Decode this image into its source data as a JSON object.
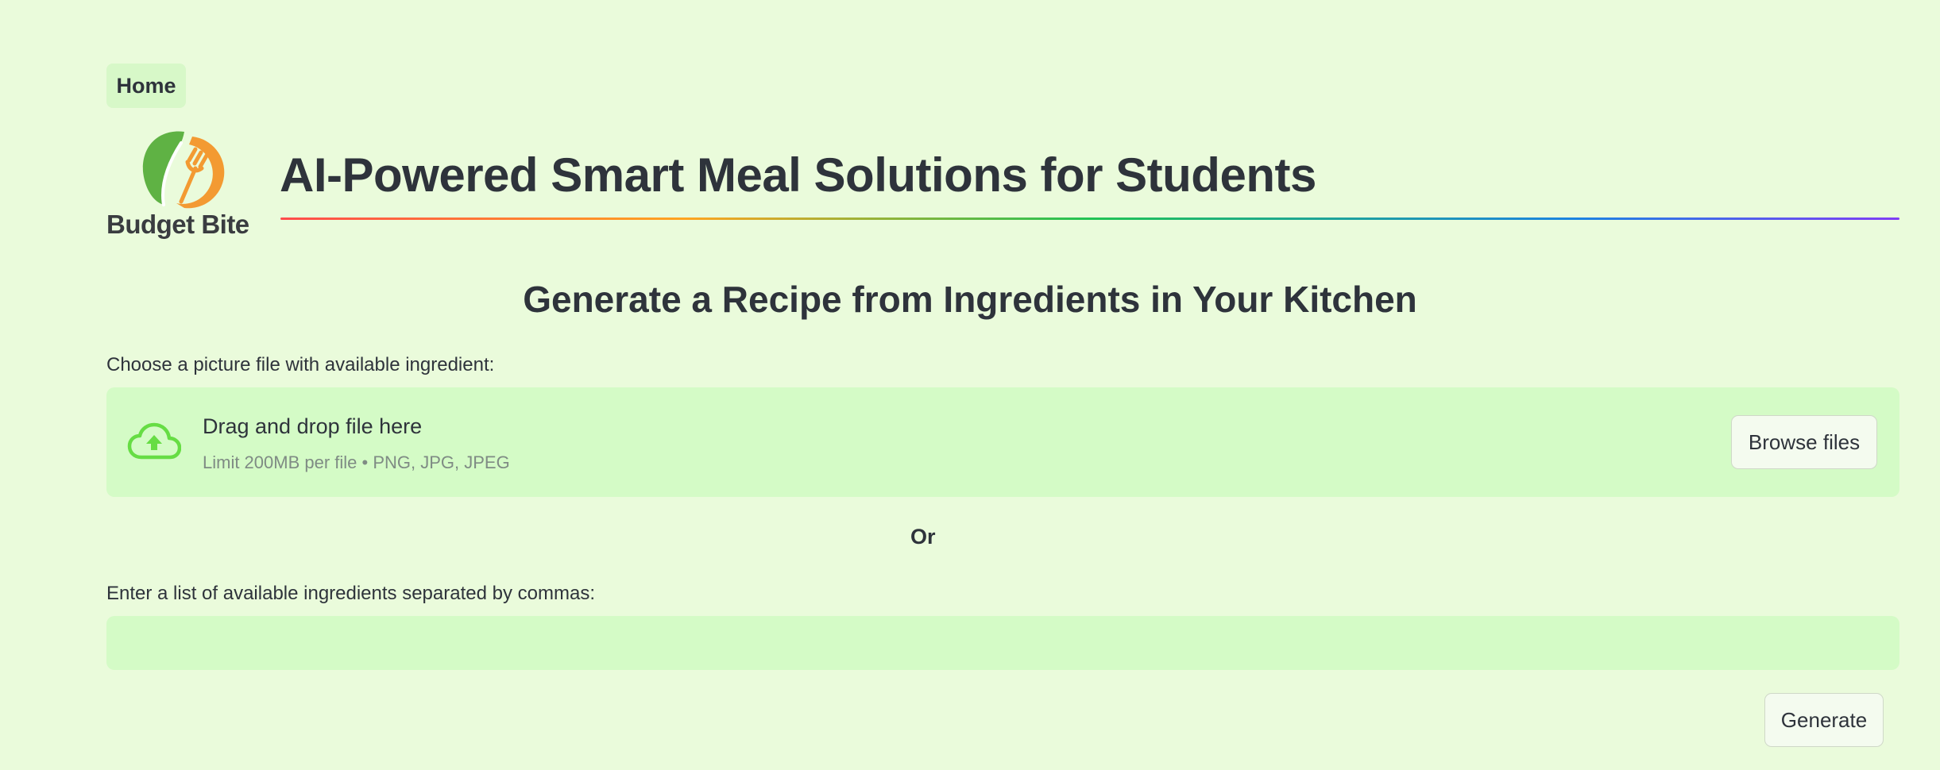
{
  "nav": {
    "home_label": "Home"
  },
  "brand": {
    "logo_text": "Budget Bite",
    "logo_icon": "leaf-fork-icon"
  },
  "header": {
    "title": "AI-Powered Smart Meal Solutions for Students"
  },
  "main": {
    "section_title": "Generate a Recipe from Ingredients in Your Kitchen",
    "upload": {
      "label": "Choose a picture file with available ingredient:",
      "drop_text": "Drag and drop file here",
      "limit_text": "Limit 200MB per file • PNG, JPG, JPEG",
      "browse_label": "Browse files",
      "icon": "cloud-upload-icon"
    },
    "or_text": "Or",
    "ingredients": {
      "label": "Enter a list of available ingredients separated by commas:",
      "value": "",
      "placeholder": ""
    },
    "generate_label": "Generate"
  },
  "colors": {
    "background": "#eafbdb",
    "panel": "#d4fbc6",
    "text": "#2e333b",
    "upload_icon": "#66dd44",
    "logo_leaf": "#5fb244",
    "logo_orange": "#f39a32"
  }
}
